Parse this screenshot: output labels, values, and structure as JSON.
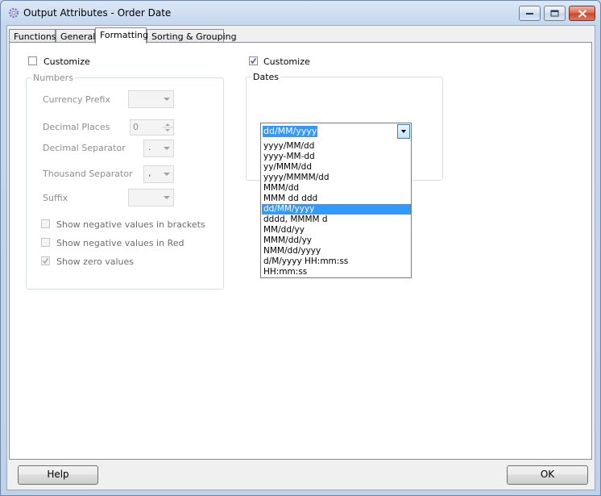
{
  "window": {
    "title": "Output Attributes - Order Date"
  },
  "tabs": [
    {
      "label": "Functions"
    },
    {
      "label": "General"
    },
    {
      "label": "Formatting"
    },
    {
      "label": "Sorting & Grouping"
    }
  ],
  "numbers": {
    "customize_label": "Customize",
    "customize_checked": false,
    "group_label": "Numbers",
    "currency_prefix_label": "Currency Prefix",
    "currency_prefix_value": "",
    "decimal_places_label": "Decimal Places",
    "decimal_places_value": "0",
    "decimal_separator_label": "Decimal Separator",
    "decimal_separator_value": ".",
    "thousand_separator_label": "Thousand Separator",
    "thousand_separator_value": ",",
    "suffix_label": "Suffix",
    "suffix_value": "",
    "neg_brackets_label": "Show negative values in brackets",
    "neg_brackets_checked": false,
    "neg_red_label": "Show negative values in Red",
    "neg_red_checked": false,
    "zero_values_label": "Show zero values",
    "zero_values_checked": true
  },
  "dates": {
    "customize_label": "Customize",
    "customize_checked": true,
    "group_label": "Dates",
    "selected_format": "dd/MM/yyyy",
    "options": [
      "yyyy/MM/dd",
      "yyyy-MM-dd",
      "yy/MMM/dd",
      "yyyy/MMMM/dd",
      "MMM/dd",
      "MMM dd ddd",
      "dd/MM/yyyy",
      "dddd, MMMM d",
      "MM/dd/yy",
      "MMM/dd/yy",
      "NMM/dd/yyyy",
      "d/M/yyyy HH:mm:ss",
      "HH:mm:ss"
    ],
    "highlighted_index": 6
  },
  "footer": {
    "help_label": "Help",
    "ok_label": "OK"
  },
  "colors": {
    "selection": "#3399ff",
    "title_bar": "#c5d7ec",
    "close_button": "#c8452c"
  }
}
